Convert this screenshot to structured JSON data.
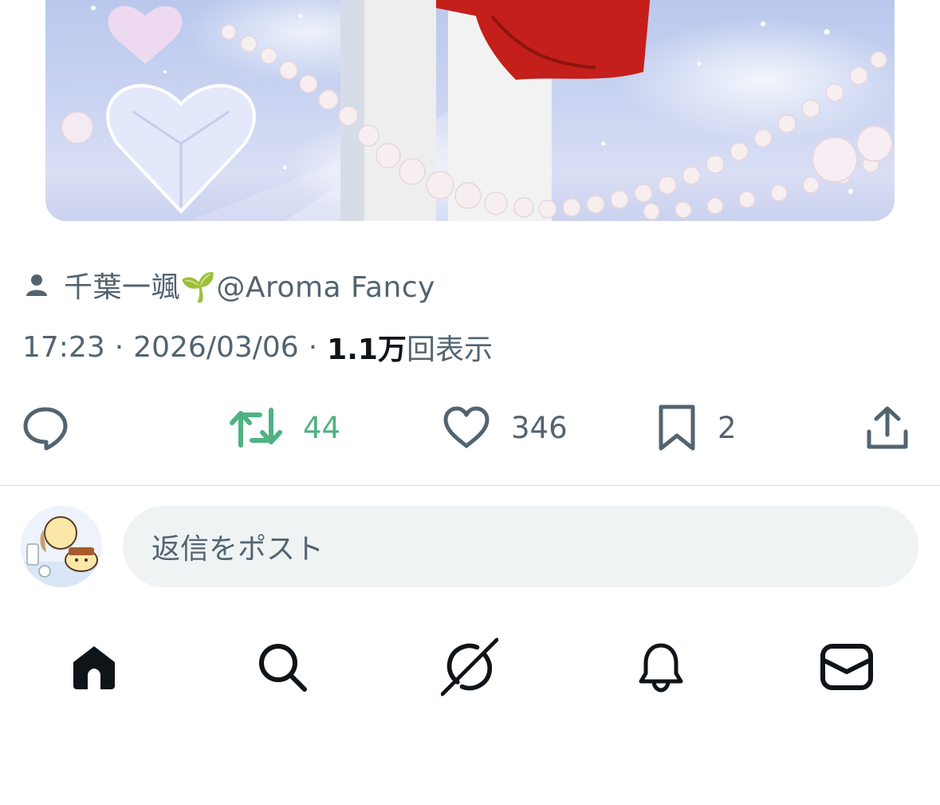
{
  "tweet": {
    "author_label": "千葉一颯🌱@Aroma Fancy",
    "time": "17:23",
    "separator": "·",
    "date": "2026/03/06",
    "views_count": "1.1万",
    "views_label": "回表示"
  },
  "actions": {
    "retweets": "44",
    "likes": "346",
    "bookmarks": "2"
  },
  "reply": {
    "placeholder": "返信をポスト"
  },
  "tabbar": {
    "icons": [
      "home-icon",
      "search-icon",
      "grok-icon",
      "notifications-icon",
      "messages-icon"
    ]
  },
  "colors": {
    "text_secondary": "#536471",
    "text_primary": "#0f1419",
    "retweet_active": "#4fb283",
    "reply_box_bg": "#eff3f4"
  }
}
